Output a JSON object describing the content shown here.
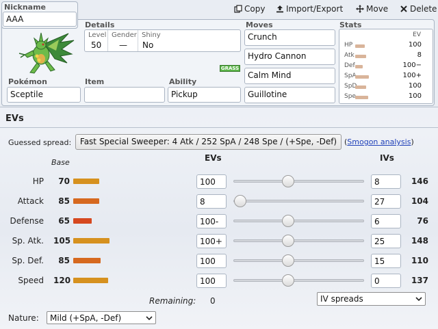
{
  "toolbar": {
    "copy": "Copy",
    "import_export": "Import/Export",
    "move": "Move",
    "delete": "Delete"
  },
  "nickname": {
    "label": "Nickname",
    "value": "AAA"
  },
  "details": {
    "label": "Details",
    "level_label": "Level",
    "level": "50",
    "gender_label": "Gender",
    "gender": "—",
    "shiny_label": "Shiny",
    "shiny": "No"
  },
  "type_badge": "GRASS",
  "pokemon": {
    "label": "Pokémon",
    "value": "Sceptile"
  },
  "item": {
    "label": "Item",
    "value": ""
  },
  "ability": {
    "label": "Ability",
    "value": "Pickup"
  },
  "moves": {
    "label": "Moves",
    "list": [
      "Crunch",
      "Hydro Cannon",
      "Calm Mind",
      "Guillotine"
    ]
  },
  "stats_panel": {
    "label": "Stats",
    "ev_header": "EV",
    "rows": [
      {
        "name": "HP",
        "ev": "100",
        "bar": 0.45
      },
      {
        "name": "Atk",
        "ev": "8",
        "bar": 0.52
      },
      {
        "name": "Def",
        "ev": "100−",
        "bar": 0.35
      },
      {
        "name": "SpA",
        "ev": "100+",
        "bar": 0.68
      },
      {
        "name": "SpD",
        "ev": "100",
        "bar": 0.52
      },
      {
        "name": "Spe",
        "ev": "100",
        "bar": 0.62
      }
    ]
  },
  "ev_section": {
    "title": "EVs",
    "guessed_label": "Guessed spread:",
    "guessed_value": "Fast Special Sweeper: 4 Atk / 252 SpA / 248 Spe / (+Spe, -Def)",
    "smogon_open": "(",
    "smogon_link": "Smogon analysis",
    "smogon_close": ")",
    "base_header": "Base",
    "evs_header": "EVs",
    "ivs_header": "IVs",
    "remaining_label": "Remaining:",
    "remaining_value": "0",
    "iv_spreads": "IV spreads",
    "nature_label": "Nature:",
    "nature_value": "Mild (+SpA, -Def)",
    "rows": [
      {
        "label": "HP",
        "base": "70",
        "base_bar": 0.29,
        "bar_color": "#d6911f",
        "ev": "100",
        "slider": 0.4,
        "iv": "8",
        "total": "146"
      },
      {
        "label": "Attack",
        "base": "85",
        "base_bar": 0.29,
        "bar_color": "#d6691f",
        "ev": "8",
        "slider": 0.03,
        "iv": "27",
        "total": "104"
      },
      {
        "label": "Defense",
        "base": "65",
        "base_bar": 0.21,
        "bar_color": "#d6481f",
        "ev": "100-",
        "slider": 0.4,
        "iv": "6",
        "total": "76"
      },
      {
        "label": "Sp. Atk.",
        "base": "105",
        "base_bar": 0.41,
        "bar_color": "#d6911f",
        "ev": "100+",
        "slider": 0.4,
        "iv": "25",
        "total": "148"
      },
      {
        "label": "Sp. Def.",
        "base": "85",
        "base_bar": 0.31,
        "bar_color": "#d6691f",
        "ev": "100",
        "slider": 0.4,
        "iv": "15",
        "total": "110"
      },
      {
        "label": "Speed",
        "base": "120",
        "base_bar": 0.39,
        "bar_color": "#d6911f",
        "ev": "100",
        "slider": 0.4,
        "iv": "0",
        "total": "137"
      }
    ]
  }
}
